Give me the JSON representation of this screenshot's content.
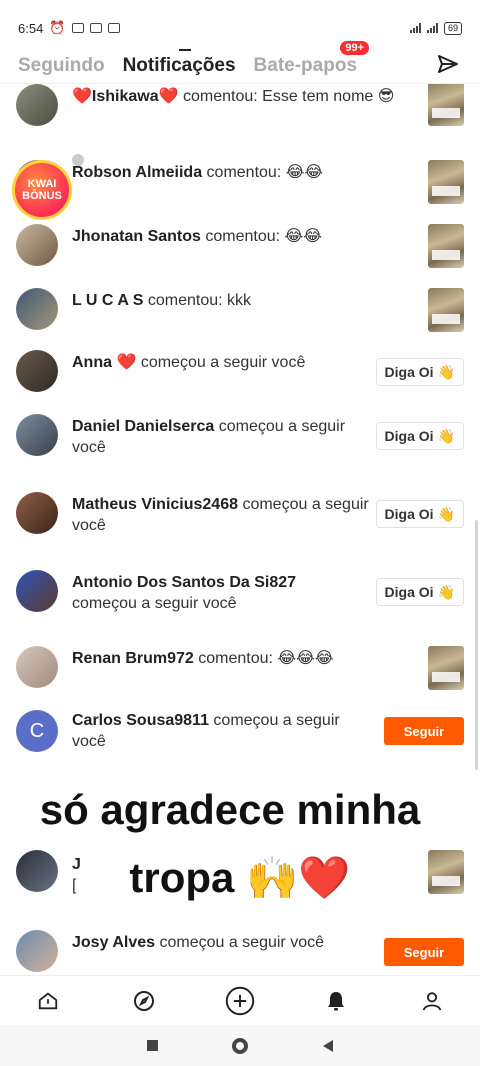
{
  "status_bar": {
    "time": "6:54",
    "battery": "69"
  },
  "tabs": [
    {
      "label": "Seguindo",
      "active": false
    },
    {
      "label": "Notificações",
      "active": true
    },
    {
      "label": "Bate-papos",
      "active": false,
      "badge": "99+"
    }
  ],
  "kwai_bonus": {
    "line1": "KWAI",
    "line2": "BÔNUS"
  },
  "notifications": [
    {
      "name": "❤️Ishikawa❤️",
      "text": " comentou: Esse tem nome 😎",
      "action": "thumb"
    },
    {
      "name": "Robson Almeiida",
      "text": " comentou: 😂😂",
      "action": "thumb"
    },
    {
      "name": "Jhonatan Santos",
      "text": " comentou: 😂😂",
      "action": "thumb"
    },
    {
      "name": "L U C A S",
      "text": " comentou: kkk",
      "action": "thumb"
    },
    {
      "name": "Anna ❤️",
      "text": " começou a seguir você",
      "action": "diga-oi"
    },
    {
      "name": "Daniel Danielserca",
      "text": " começou a seguir você",
      "action": "diga-oi"
    },
    {
      "name": "Matheus Vinicius2468",
      "text": " começou a seguir você",
      "action": "diga-oi"
    },
    {
      "name": "Antonio Dos Santos Da Si827",
      "text": " começou a seguir você",
      "action": "diga-oi"
    },
    {
      "name": "Renan Brum972",
      "text": " comentou: 😂😂😂",
      "action": "thumb"
    },
    {
      "name": "Carlos Sousa9811",
      "text": " começou a seguir você",
      "action": "seguir",
      "avatar_letter": "C"
    },
    {
      "name": "J",
      "text": "",
      "action": "thumb",
      "partial": "["
    },
    {
      "name": "Josy Alves",
      "text": " começou a seguir você",
      "action": "seguir"
    }
  ],
  "buttons": {
    "diga_oi": "Diga Oi",
    "seguir": "Seguir"
  },
  "overlay_caption": {
    "line1": "só agradece minha",
    "line2": "tropa 🙌❤️"
  },
  "colors": {
    "accent": "#ff5a00",
    "badge": "#ff2d2d"
  },
  "bottom_nav": [
    "home-icon",
    "explore-icon",
    "create-icon",
    "notifications-icon",
    "profile-icon"
  ]
}
